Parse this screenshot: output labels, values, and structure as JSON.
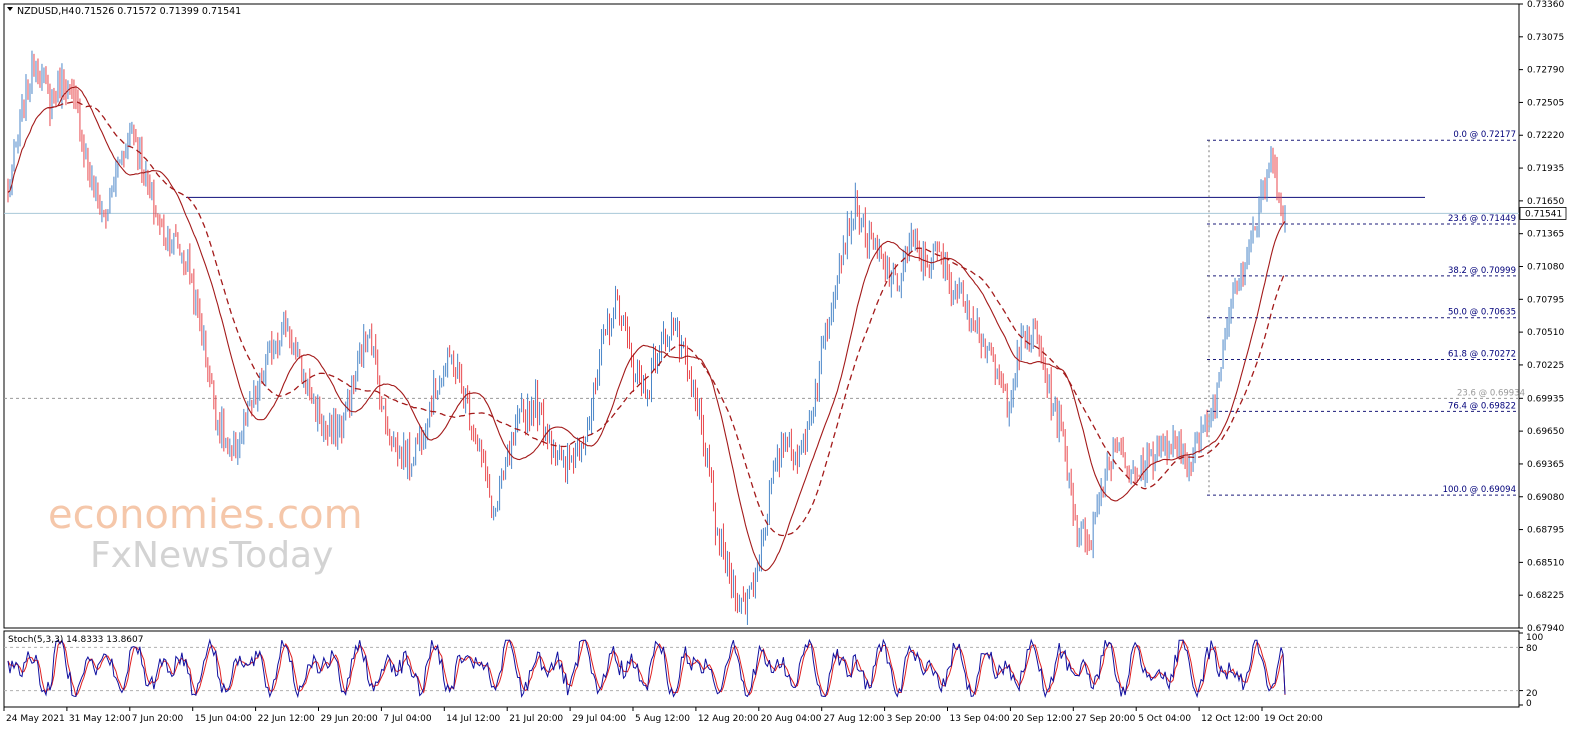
{
  "header": {
    "symbol": "NZDUSD,H4",
    "ohlc": "0.71526 0.71572 0.71399 0.71541"
  },
  "watermark": {
    "line1": "economies.com",
    "line2": "FxNewsToday"
  },
  "stoch": {
    "label": "Stoch(5,3,3) 14.8333 13.8607",
    "yticks": [
      "100",
      "80",
      "20",
      "0"
    ],
    "levels": [
      20,
      80
    ]
  },
  "colors": {
    "bull": "#4a86c8",
    "bear": "#e8474c",
    "ma": "#a31a1a",
    "hline": "#2a2a8a",
    "fib": "#1b1b7a",
    "stochMain": "#1010a0",
    "stochSignal": "#e02020"
  },
  "chart_data": {
    "type": "candlestick",
    "title": "NZDUSD,H4",
    "ylim": [
      0.6794,
      0.7336
    ],
    "yticks": [
      0.7336,
      0.73075,
      0.7279,
      0.72505,
      0.7222,
      0.71935,
      0.7165,
      0.71365,
      0.7108,
      0.70795,
      0.7051,
      0.70225,
      0.69935,
      0.6965,
      0.69365,
      0.6908,
      0.68795,
      0.6851,
      0.68225,
      0.6794
    ],
    "xlabels": [
      "24 May 2021",
      "31 May 12:00",
      "7 Jun 20:00",
      "15 Jun 04:00",
      "22 Jun 12:00",
      "29 Jun 20:00",
      "7 Jul 04:00",
      "14 Jul 12:00",
      "21 Jul 20:00",
      "29 Jul 04:00",
      "5 Aug 12:00",
      "12 Aug 20:00",
      "20 Aug 04:00",
      "27 Aug 12:00",
      "3 Sep 20:00",
      "13 Sep 04:00",
      "20 Sep 12:00",
      "27 Sep 20:00",
      "5 Oct 04:00",
      "12 Oct 12:00",
      "19 Oct 20:00"
    ],
    "close_track": [
      0.717,
      0.724,
      0.729,
      0.725,
      0.727,
      0.724,
      0.718,
      0.715,
      0.72,
      0.723,
      0.718,
      0.714,
      0.713,
      0.711,
      0.705,
      0.698,
      0.694,
      0.697,
      0.7,
      0.704,
      0.706,
      0.702,
      0.699,
      0.696,
      0.697,
      0.701,
      0.706,
      0.698,
      0.695,
      0.694,
      0.697,
      0.701,
      0.703,
      0.699,
      0.695,
      0.689,
      0.694,
      0.698,
      0.699,
      0.696,
      0.693,
      0.695,
      0.698,
      0.705,
      0.708,
      0.702,
      0.7,
      0.704,
      0.706,
      0.701,
      0.697,
      0.688,
      0.684,
      0.681,
      0.685,
      0.692,
      0.696,
      0.694,
      0.699,
      0.706,
      0.712,
      0.716,
      0.713,
      0.711,
      0.709,
      0.713,
      0.711,
      0.712,
      0.709,
      0.708,
      0.705,
      0.702,
      0.699,
      0.704,
      0.705,
      0.7,
      0.696,
      0.688,
      0.687,
      0.693,
      0.696,
      0.692,
      0.694,
      0.695,
      0.695,
      0.694,
      0.696,
      0.699,
      0.708,
      0.711,
      0.715,
      0.72,
      0.715
    ],
    "horizontal_line": 0.7168,
    "current_price": 0.71541,
    "grey_level": 0.69934,
    "fibonacci": [
      {
        "label": "0.0 @ 0.72177",
        "value": 0.72177
      },
      {
        "label": "23.6 @ 0.71449",
        "value": 0.71449
      },
      {
        "label": "38.2 @ 0.70999",
        "value": 0.70999
      },
      {
        "label": "50.0 @ 0.70635",
        "value": 0.70635
      },
      {
        "label": "61.8 @ 0.70272",
        "value": 0.70272
      },
      {
        "label": "76.4 @ 0.69822",
        "value": 0.69822
      },
      {
        "label": "100.0 @ 0.69094",
        "value": 0.69094
      }
    ],
    "fib_extra_label": "23.6 @ 0.69934",
    "price_label": "0.71541"
  }
}
